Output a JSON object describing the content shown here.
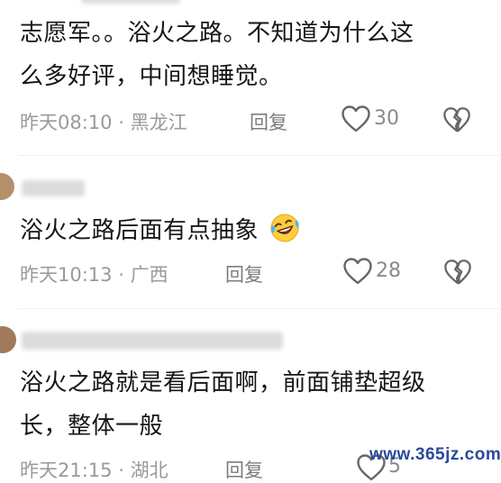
{
  "comments": [
    {
      "text_line1": "志愿军。。浴火之路。不知道为什么这",
      "text_line2": "么多好评，中间想睡觉。",
      "time": "昨天08:10",
      "location": "黑龙江",
      "reply_label": "回复",
      "likes": "30"
    },
    {
      "text_line1": "浴火之路后面有点抽象",
      "emoji": "laughing-tears-emoji",
      "time": "昨天10:13",
      "location": "广西",
      "reply_label": "回复",
      "likes": "28"
    },
    {
      "text_line1": "浴火之路就是看后面啊，前面铺垫超级",
      "text_line2": "长，整体一般",
      "time": "昨天21:15",
      "location": "湖北",
      "reply_label": "回复",
      "likes": "5"
    }
  ],
  "separator": "·",
  "watermark": "www.365jz.com",
  "colors": {
    "meta_gray": "#9a9a9a",
    "icon_gray": "#666666",
    "watermark_blue": "#2a4a9a"
  }
}
